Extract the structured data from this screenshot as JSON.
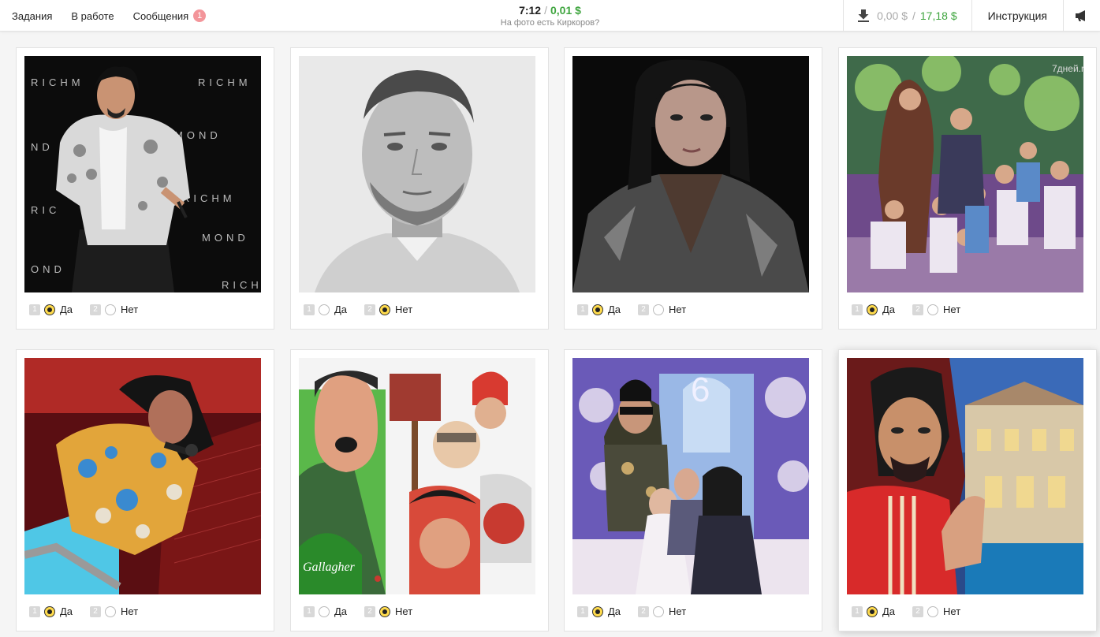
{
  "nav": {
    "tasks": "Задания",
    "in_work": "В работе",
    "messages": "Сообщения",
    "messages_count": "1"
  },
  "header": {
    "timer": "7:12",
    "price": "0,01 $",
    "question": "На фото есть Киркоров?"
  },
  "balance": {
    "pending": "0,00 $",
    "total": "17,18 $"
  },
  "instruction_label": "Инструкция",
  "cards": [
    {
      "yes_key": "1",
      "yes": "Да",
      "no_key": "2",
      "no": "Нет",
      "selected": "yes"
    },
    {
      "yes_key": "1",
      "yes": "Да",
      "no_key": "2",
      "no": "Нет",
      "selected": "no"
    },
    {
      "yes_key": "1",
      "yes": "Да",
      "no_key": "2",
      "no": "Нет",
      "selected": "yes"
    },
    {
      "yes_key": "1",
      "yes": "Да",
      "no_key": "2",
      "no": "Нет",
      "selected": "yes"
    },
    {
      "yes_key": "1",
      "yes": "Да",
      "no_key": "2",
      "no": "Нет",
      "selected": "yes"
    },
    {
      "yes_key": "1",
      "yes": "Да",
      "no_key": "2",
      "no": "Нет",
      "selected": "no"
    },
    {
      "yes_key": "1",
      "yes": "Да",
      "no_key": "2",
      "no": "Нет",
      "selected": "yes"
    },
    {
      "yes_key": "1",
      "yes": "Да",
      "no_key": "2",
      "no": "Нет",
      "selected": "yes"
    }
  ],
  "photo_watermark": "7дней.ru"
}
